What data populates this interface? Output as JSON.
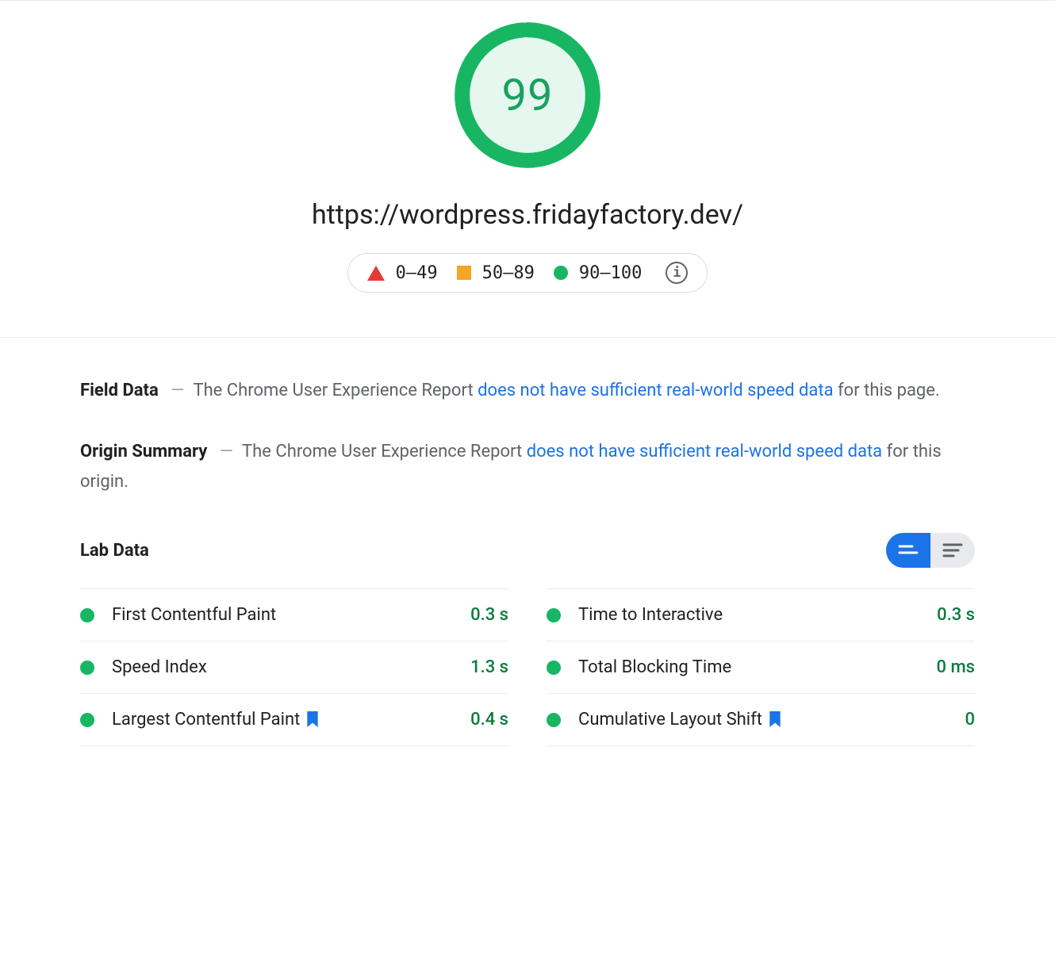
{
  "score": "99",
  "url": "https://wordpress.fridayfactory.dev/",
  "legend": {
    "bad": "0–49",
    "mid": "50–89",
    "good": "90–100"
  },
  "field_data": {
    "title": "Field Data",
    "dash": "—",
    "prefix": "The Chrome User Experience Report ",
    "link": "does not have sufficient real-world speed data",
    "suffix": " for this page."
  },
  "origin_summary": {
    "title": "Origin Summary",
    "dash": "—",
    "prefix": "The Chrome User Experience Report ",
    "link": "does not have sufficient real-world speed data",
    "suffix": " for this origin."
  },
  "lab": {
    "title": "Lab Data",
    "left": [
      {
        "name": "First Contentful Paint",
        "value": "0.3 s",
        "flag": false
      },
      {
        "name": "Speed Index",
        "value": "1.3 s",
        "flag": false
      },
      {
        "name": "Largest Contentful Paint",
        "value": "0.4 s",
        "flag": true
      }
    ],
    "right": [
      {
        "name": "Time to Interactive",
        "value": "0.3 s",
        "flag": false
      },
      {
        "name": "Total Blocking Time",
        "value": "0 ms",
        "flag": false
      },
      {
        "name": "Cumulative Layout Shift",
        "value": "0",
        "flag": true
      }
    ]
  }
}
